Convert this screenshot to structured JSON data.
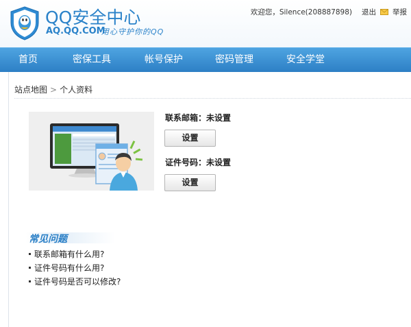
{
  "header": {
    "title": "QQ安全中心",
    "url": "AQ.QQ.COM",
    "slogan": "用心守护你的QQ",
    "greeting": "欢迎您，Silence(208887898)",
    "logout_label": "退出",
    "report_label": "举报"
  },
  "nav": {
    "items": [
      {
        "label": "首页"
      },
      {
        "label": "密保工具"
      },
      {
        "label": "帐号保护"
      },
      {
        "label": "密码管理"
      },
      {
        "label": "安全学堂"
      }
    ]
  },
  "breadcrumb": {
    "root": "站点地图",
    "separator": ">",
    "current": "个人资料"
  },
  "settings": {
    "email_label": "联系邮箱：未设置",
    "email_button": "设置",
    "id_label": "证件号码：未设置",
    "id_button": "设置"
  },
  "faq": {
    "title": "常见问题",
    "items": [
      {
        "text": "联系邮箱有什么用?"
      },
      {
        "text": "证件号码有什么用?"
      },
      {
        "text": "证件号码是否可以修改?"
      }
    ]
  },
  "colors": {
    "brand": "#2a82c9",
    "nav_bg": "#3a8fd1",
    "nav_text": "#ffffff"
  },
  "icons": [
    "qq-shield-logo-icon",
    "mail-icon",
    "computer-user-illustration"
  ]
}
